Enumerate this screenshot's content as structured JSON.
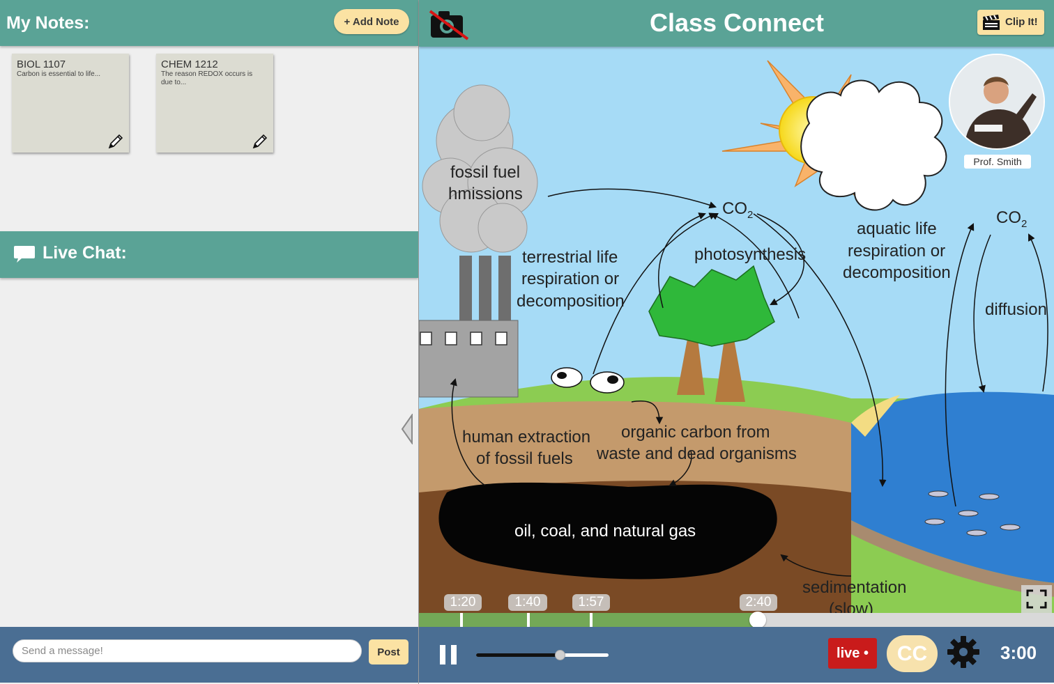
{
  "notes": {
    "title": "My Notes:",
    "add_label": "+ Add Note",
    "items": [
      {
        "title": "BIOL 1107",
        "body": "Carbon is essential to life..."
      },
      {
        "title": "CHEM 1212",
        "body": "The reason REDOX occurs is due to..."
      }
    ]
  },
  "chat": {
    "title": "Live Chat:",
    "placeholder": "Send a message!",
    "post_label": "Post"
  },
  "player": {
    "title": "Class Connect",
    "clip_label": "Clip It!",
    "instructor_name": "Prof. Smith",
    "markers": [
      "1:20",
      "1:40",
      "1:57",
      "2:40"
    ],
    "progress_fraction": 0.533,
    "volume_fraction": 0.63,
    "live_label": "live •",
    "cc_label": "CC",
    "duration": "3:00",
    "colors": {
      "teal": "#5aa396",
      "navy": "#4a6e93",
      "accent": "#fbe2a3",
      "live": "#c91b1b",
      "progress": "#73a857"
    }
  },
  "diagram": {
    "fossil1": "fossil fuel",
    "fossil2": "hmissions",
    "co2_left": "CO",
    "co2_right": "CO",
    "sub2": "2",
    "photosynthesis": "photosynthesis",
    "terr1": "terrestrial life",
    "terr2": "respiration or",
    "terr3": "decomposition",
    "aqua1": "aquatic life",
    "aqua2": "respiration or",
    "aqua3": "decomposition",
    "diffusion": "diffusion",
    "human1": "human extraction",
    "human2": "of fossil fuels",
    "org1": "organic carbon from",
    "org2": "waste and dead organisms",
    "oil": "oil, coal, and natural gas",
    "sed1": "sedimentation",
    "sed2": "(slow)"
  }
}
